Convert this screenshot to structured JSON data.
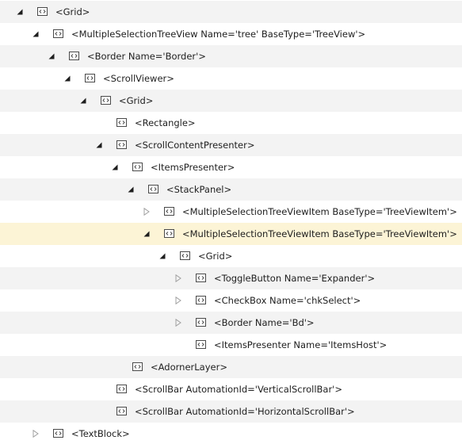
{
  "tree": {
    "nodes": [
      {
        "label": "<Grid>",
        "level": 0,
        "state": "expanded",
        "shade": true,
        "selected": false
      },
      {
        "label": "<MultipleSelectionTreeView Name='tree' BaseType='TreeView'>",
        "level": 1,
        "state": "expanded",
        "shade": false,
        "selected": false
      },
      {
        "label": "<Border Name='Border'>",
        "level": 2,
        "state": "expanded",
        "shade": true,
        "selected": false
      },
      {
        "label": "<ScrollViewer>",
        "level": 3,
        "state": "expanded",
        "shade": false,
        "selected": false
      },
      {
        "label": "<Grid>",
        "level": 4,
        "state": "expanded",
        "shade": true,
        "selected": false
      },
      {
        "label": "<Rectangle>",
        "level": 5,
        "state": "leaf",
        "shade": false,
        "selected": false
      },
      {
        "label": "<ScrollContentPresenter>",
        "level": 5,
        "state": "expanded",
        "shade": true,
        "selected": false
      },
      {
        "label": "<ItemsPresenter>",
        "level": 6,
        "state": "expanded",
        "shade": false,
        "selected": false
      },
      {
        "label": "<StackPanel>",
        "level": 7,
        "state": "expanded",
        "shade": true,
        "selected": false
      },
      {
        "label": "<MultipleSelectionTreeViewItem BaseType='TreeViewItem'>",
        "level": 8,
        "state": "collapsed",
        "shade": false,
        "selected": false
      },
      {
        "label": "<MultipleSelectionTreeViewItem BaseType='TreeViewItem'>",
        "level": 8,
        "state": "expanded",
        "shade": false,
        "selected": true
      },
      {
        "label": "<Grid>",
        "level": 9,
        "state": "expanded",
        "shade": false,
        "selected": false
      },
      {
        "label": "<ToggleButton Name='Expander'>",
        "level": 10,
        "state": "collapsed",
        "shade": true,
        "selected": false
      },
      {
        "label": "<CheckBox Name='chkSelect'>",
        "level": 10,
        "state": "collapsed",
        "shade": false,
        "selected": false
      },
      {
        "label": "<Border Name='Bd'>",
        "level": 10,
        "state": "collapsed",
        "shade": true,
        "selected": false
      },
      {
        "label": "<ItemsPresenter Name='ItemsHost'>",
        "level": 10,
        "state": "leaf",
        "shade": false,
        "selected": false
      },
      {
        "label": "<AdornerLayer>",
        "level": 6,
        "state": "leaf",
        "shade": true,
        "selected": false
      },
      {
        "label": "<ScrollBar AutomationId='VerticalScrollBar'>",
        "level": 5,
        "state": "leaf",
        "shade": false,
        "selected": false
      },
      {
        "label": "<ScrollBar AutomationId='HorizontalScrollBar'>",
        "level": 5,
        "state": "leaf",
        "shade": true,
        "selected": false
      },
      {
        "label": "<TextBlock>",
        "level": 1,
        "state": "collapsed",
        "shade": false,
        "selected": false
      }
    ]
  },
  "icons": {
    "expanded": "expanded-triangle-icon",
    "collapsed": "collapsed-triangle-icon",
    "element": "xaml-element-icon"
  },
  "colors": {
    "row_alt": "#f3f3f3",
    "row_selected": "#fcf4d6",
    "text": "#1e1e1e",
    "glyph_dark": "#1e1e1e",
    "glyph_light": "#a0a0a0",
    "icon_stroke": "#4a4a4a"
  }
}
